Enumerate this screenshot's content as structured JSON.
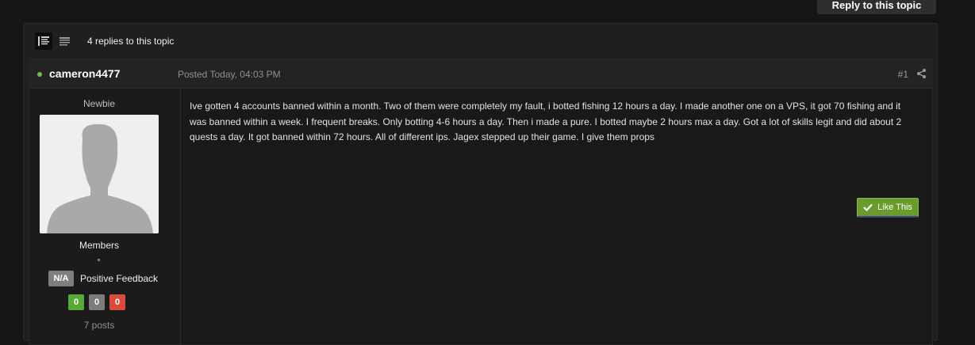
{
  "reply_button_label": "Reply to this topic",
  "topic": {
    "reply_count_text": "4 replies to this topic"
  },
  "post": {
    "username": "cameron4477",
    "posted_text": "Posted Today, 04:03 PM",
    "post_number": "#1",
    "body": "Ive gotten 4 accounts banned within a month. Two of them were completely  my fault, i botted fishing 12 hours a day. I made another one on a VPS, it got 70 fishing and it was banned within a week. I frequent breaks. Only botting 4-6 hours a day. Then i made a pure. I botted maybe 2 hours max a day. Got a lot of skills legit and did about 2 quests a day. It got banned within 72 hours. All of different ips. Jagex stepped up their game. I give them props",
    "like_label": "Like This"
  },
  "author": {
    "rank_title": "Newbie",
    "group": "Members",
    "feedback_badge": "N/A",
    "feedback_label": "Positive Feedback",
    "feedback_counts": {
      "positive": "0",
      "neutral": "0",
      "negative": "0"
    },
    "posts_count": "7 posts"
  },
  "icons": {
    "online": "online-dot",
    "share": "share-icon",
    "like": "checkmark-icon",
    "mode_full": "full-view-icon",
    "mode_compact": "compact-view-icon"
  },
  "colors": {
    "online": "#6fbf3a",
    "like_button": "#6b9b2d",
    "feedback_positive": "#5aa83a",
    "feedback_neutral": "#7c7c7c",
    "feedback_negative": "#d94b3f"
  }
}
